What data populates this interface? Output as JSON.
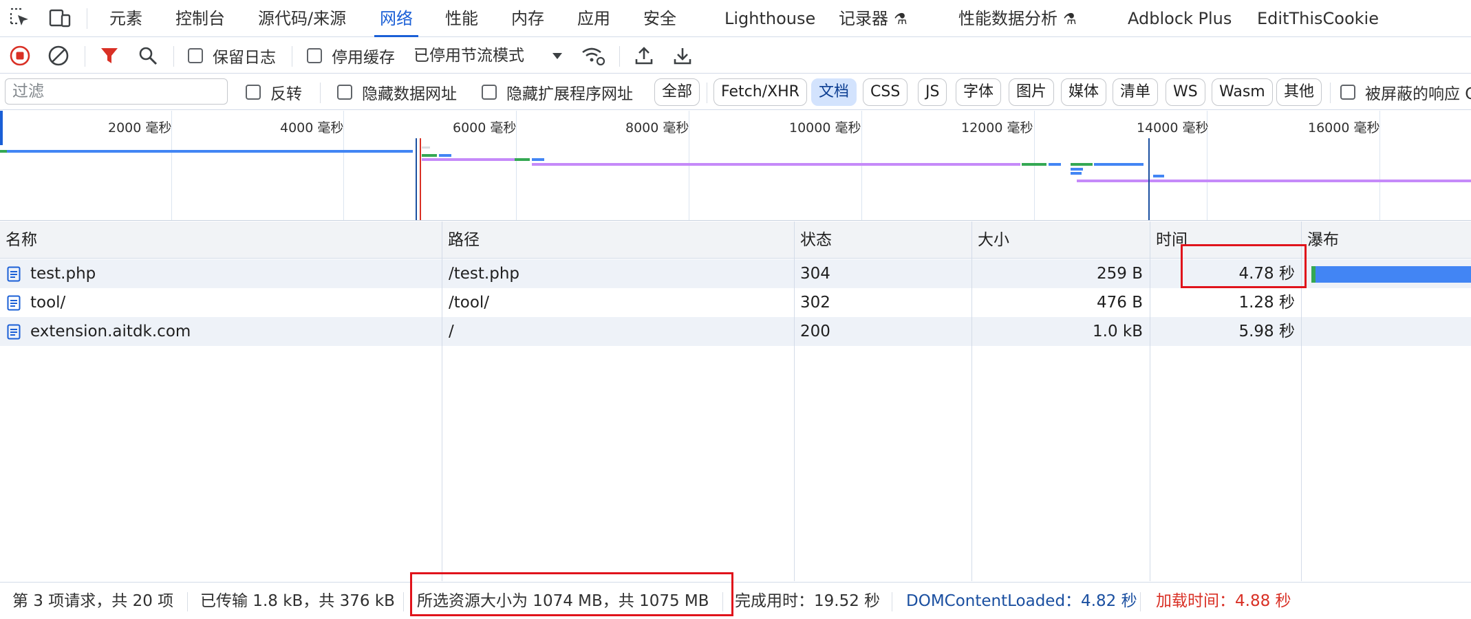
{
  "tabs": [
    {
      "label": "元素"
    },
    {
      "label": "控制台"
    },
    {
      "label": "源代码/来源"
    },
    {
      "label": "网络"
    },
    {
      "label": "性能"
    },
    {
      "label": "内存"
    },
    {
      "label": "应用"
    },
    {
      "label": "安全"
    },
    {
      "label": "Lighthouse"
    },
    {
      "label": "记录器"
    },
    {
      "label": "性能数据分析"
    },
    {
      "label": "Adblock Plus"
    },
    {
      "label": "EditThisCookie"
    }
  ],
  "active_tab": "网络",
  "toolbar": {
    "preserve_log_label": "保留日志",
    "disable_cache_label": "停用缓存",
    "throttling_value": "已停用节流模式"
  },
  "filterbar": {
    "filter_placeholder": "过滤",
    "invert_label": "反转",
    "hide_data_urls_label": "隐藏数据网址",
    "hide_extension_urls_label": "隐藏扩展程序网址",
    "type_filters": [
      "全部",
      "Fetch/XHR",
      "文档",
      "CSS",
      "JS",
      "字体",
      "图片",
      "媒体",
      "清单",
      "WS",
      "Wasm",
      "其他"
    ],
    "active_type_filter": "文档",
    "blocked_responses_label": "被屏蔽的响应 C"
  },
  "overview": {
    "tick_labels": [
      "2000 毫秒",
      "4000 毫秒",
      "6000 毫秒",
      "8000 毫秒",
      "10000 毫秒",
      "12000 毫秒",
      "14000 毫秒",
      "16000 毫秒"
    ]
  },
  "table": {
    "columns": [
      "名称",
      "路径",
      "状态",
      "大小",
      "时间",
      "瀑布"
    ],
    "rows": [
      {
        "name": "test.php",
        "path": "/test.php",
        "status": "304",
        "size": "259 B",
        "time": "4.78 秒"
      },
      {
        "name": "tool/",
        "path": "/tool/",
        "status": "302",
        "size": "476 B",
        "time": "1.28 秒"
      },
      {
        "name": "extension.aitdk.com",
        "path": "/",
        "status": "200",
        "size": "1.0 kB",
        "time": "5.98 秒"
      }
    ]
  },
  "statusbar": {
    "requests": "第 3 项请求，共 20 项",
    "transferred": "已传输 1.8 kB，共 376 kB",
    "resources": "所选资源大小为 1074 MB，共 1075 MB",
    "finish": "完成用时：19.52 秒",
    "dom_content_loaded": "DOMContentLoaded：4.82 秒",
    "load": "加载时间：4.88 秒"
  },
  "colors": {
    "accent": "#1a5fd6",
    "record_red": "#d93025",
    "highlight_red": "#e0131b",
    "waterfall_blue": "#4285f4",
    "waterfall_green": "#34a853",
    "waterfall_purple": "#c58af9"
  }
}
